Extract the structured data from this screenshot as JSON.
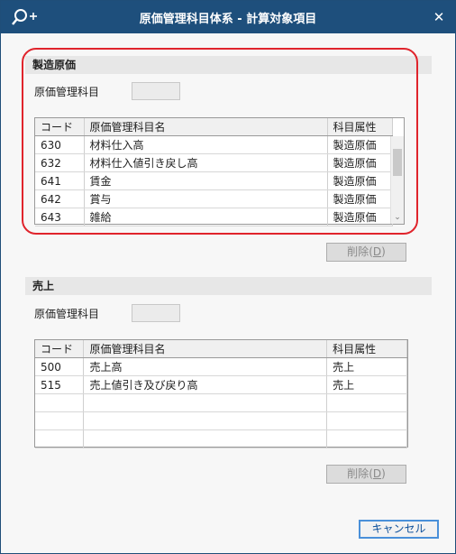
{
  "window": {
    "title": "原価管理科目体系 - 計算対象項目"
  },
  "icons": {
    "search": "search-plus-icon",
    "close": "close-icon"
  },
  "manufacturing": {
    "header": "製造原価",
    "field_label": "原価管理科目",
    "columns": [
      "コード",
      "原価管理科目名",
      "科目属性"
    ],
    "rows": [
      [
        "630",
        "材料仕入高",
        "製造原価"
      ],
      [
        "632",
        "材料仕入値引き戻し高",
        "製造原価"
      ],
      [
        "641",
        "賃金",
        "製造原価"
      ],
      [
        "642",
        "賞与",
        "製造原価"
      ],
      [
        "643",
        "雑給",
        "製造原価"
      ]
    ],
    "delete_label": "削除",
    "delete_key": "D"
  },
  "sales": {
    "header": "売上",
    "field_label": "原価管理科目",
    "columns": [
      "コード",
      "原価管理科目名",
      "科目属性"
    ],
    "rows": [
      [
        "500",
        "売上高",
        "売上"
      ],
      [
        "515",
        "売上値引き及び戻り高",
        "売上"
      ],
      [
        "",
        "",
        ""
      ],
      [
        "",
        "",
        ""
      ],
      [
        "",
        "",
        ""
      ]
    ],
    "delete_label": "削除",
    "delete_key": "D"
  },
  "cancel_label": "キャンセル",
  "colors": {
    "titlebar": "#1e4f7c",
    "highlight": "#e0242c",
    "cancel_border": "#4a90d9"
  }
}
